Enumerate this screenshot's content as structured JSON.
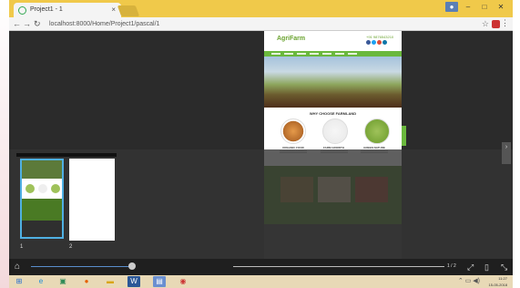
{
  "browser": {
    "tab_title": "Project1 - 1",
    "tab_close": "×",
    "url": "localhost:8000/Home/Project1/pascal/1",
    "star": "☆",
    "menu": "⋮",
    "window_controls": [
      "–",
      "□",
      "✕"
    ]
  },
  "document": {
    "logo": "AgriFarm",
    "phone": "+91 9876543210",
    "section_title": "WHY CHOOSE FARMLAND",
    "captions": [
      "ORGANIC FOOD",
      "FARM GROWTH",
      "GREEN NATURE"
    ]
  },
  "thumbnails": {
    "page_numbers": [
      "1",
      "2"
    ]
  },
  "controls": {
    "home": "⌂",
    "page_count": "1 / 2",
    "fit": "⤢",
    "single": "▯",
    "fullscreen": "⤡",
    "progress_fraction": 0.21
  },
  "taskbar": {
    "icons": [
      "windows-icon",
      "ie-icon",
      "store-icon",
      "firefox-icon",
      "folder-icon",
      "word-icon",
      "app-icon",
      "chrome-icon"
    ],
    "time": "11:27",
    "date": "15-05-2018"
  },
  "colors": {
    "accent_green": "#6ab83d",
    "selection_blue": "#4fb0e3",
    "title_bar": "#f0c94a"
  }
}
